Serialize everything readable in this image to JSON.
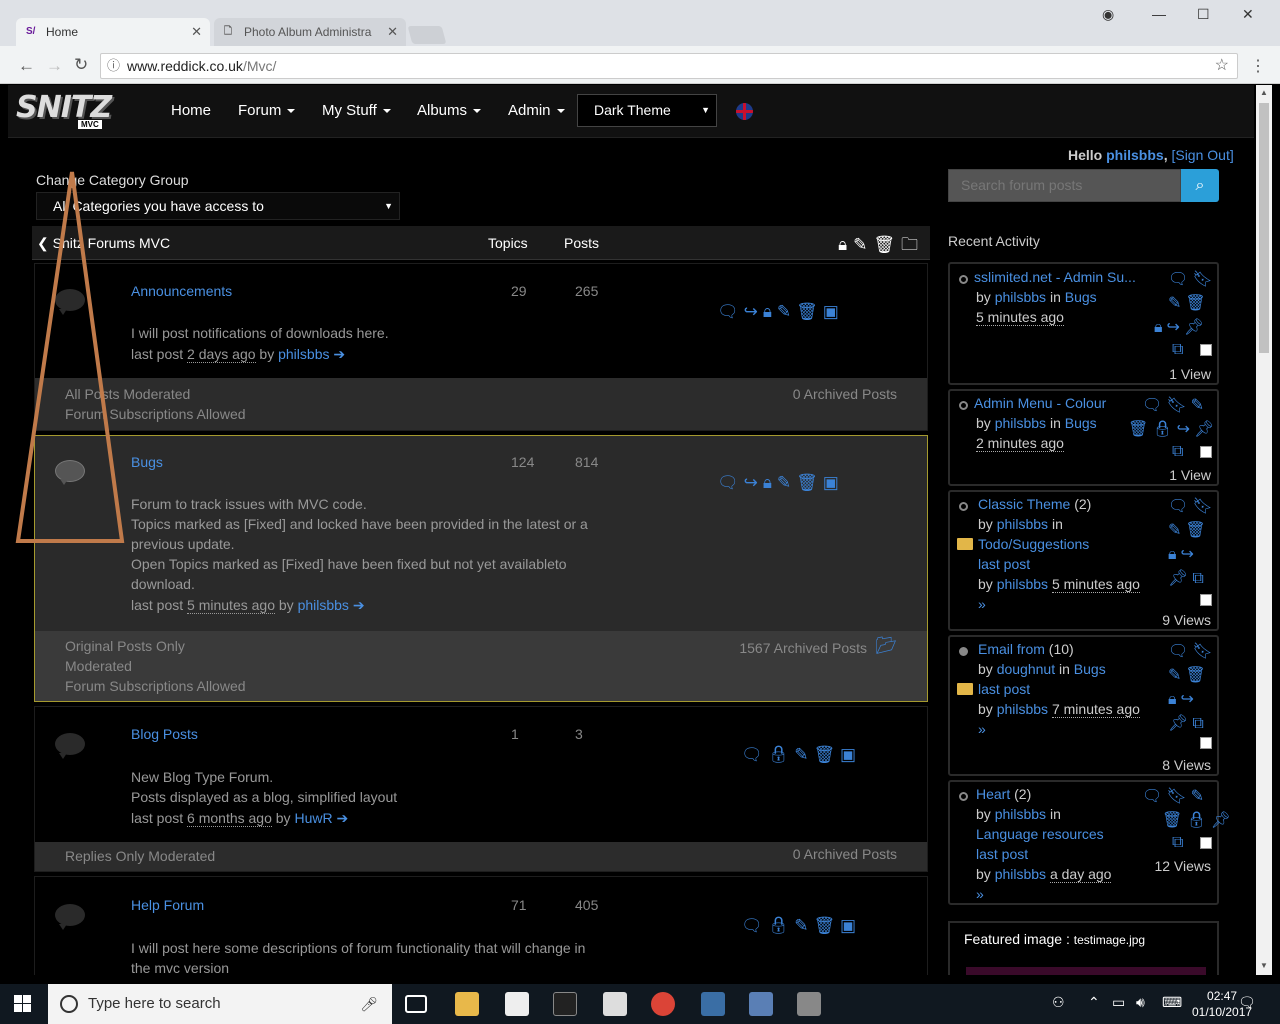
{
  "browser": {
    "tabs": [
      {
        "label": "Home",
        "icon": "snitz-favicon"
      },
      {
        "label": "Photo Album Administra",
        "icon": "document-icon"
      }
    ],
    "url_host": "www.reddick.co.uk",
    "url_path": "/Mvc/"
  },
  "nav": {
    "logo": "SNITZ",
    "logo_sub": "MVC",
    "items": [
      "Home",
      "Forum",
      "My Stuff",
      "Albums",
      "Admin"
    ],
    "theme_select": "Dark Theme"
  },
  "category": {
    "label": "Change Category Group",
    "selected": "All Categories you have access to"
  },
  "forum_header": {
    "title": "Snitz Forums MVC",
    "topics_col": "Topics",
    "posts_col": "Posts"
  },
  "forums": [
    {
      "name": "Announcements",
      "topics": "29",
      "posts": "265",
      "desc": [
        "I will post notifications of downloads here."
      ],
      "last_post_label": "last post",
      "last_post_ago": "2 days ago",
      "by": "by",
      "user": "philsbbs",
      "footer_left": [
        "All Posts Moderated",
        "Forum Subscriptions Allowed"
      ],
      "footer_right": "0 Archived Posts"
    },
    {
      "name": "Bugs",
      "topics": "124",
      "posts": "814",
      "desc": [
        "Forum to track issues with MVC code.",
        "Topics marked as [Fixed] and locked have been provided in the latest or a",
        "previous update.",
        "Open Topics marked as [Fixed] have been fixed but not yet availableto",
        "download."
      ],
      "last_post_label": "last post",
      "last_post_ago": "5 minutes ago",
      "by": "by",
      "user": "philsbbs",
      "footer_left": [
        "Original Posts Only",
        "Moderated",
        "Forum Subscriptions Allowed"
      ],
      "footer_right": "1567 Archived Posts"
    },
    {
      "name": "Blog Posts",
      "topics": "1",
      "posts": "3",
      "desc": [
        "New Blog Type Forum.",
        "Posts displayed as a blog, simplified layout"
      ],
      "last_post_label": "last post",
      "last_post_ago": "6 months ago",
      "by": "by",
      "user": "HuwR",
      "footer_left": [
        "Replies Only Moderated"
      ],
      "footer_right": "0 Archived Posts"
    },
    {
      "name": "Help Forum",
      "topics": "71",
      "posts": "405",
      "desc": [
        "I will post here some descriptions of forum functionality that will change in",
        "the mvc version"
      ]
    }
  ],
  "sidebar": {
    "hello": "Hello",
    "user": "philsbbs",
    "sign_out": "[Sign Out]",
    "search_placeholder": "Search forum posts",
    "recent_title": "Recent Activity",
    "recent": [
      {
        "title": "sslimited.net - Admin Su...",
        "by": "by",
        "author": "philsbbs",
        "in": "in",
        "forum": "Bugs",
        "ago": "5 minutes ago",
        "views": "1 View"
      },
      {
        "title": "Admin Menu - Colour",
        "by": "by",
        "author": "philsbbs",
        "in": "in",
        "forum": "Bugs",
        "ago": "2 minutes ago",
        "views": "1 View"
      },
      {
        "title": "Classic Theme",
        "count": "(2)",
        "by": "by",
        "author": "philsbbs",
        "in": "in",
        "forum": "Todo/Suggestions",
        "last_post": "last post",
        "last_by": "philsbbs",
        "ago": "5 minutes ago",
        "more": "»",
        "views": "9 Views"
      },
      {
        "title": "Email from",
        "count": "(10)",
        "by": "by",
        "author": "doughnut",
        "in": "in",
        "forum": "Bugs",
        "last_post": "last post",
        "last_by": "philsbbs",
        "ago": "7 minutes ago",
        "more": "»",
        "views": "8 Views"
      },
      {
        "title": "Heart",
        "count": "(2)",
        "by": "by",
        "author": "philsbbs",
        "in": "in",
        "forum": "Language resources",
        "last_post": "last post",
        "last_by": "philsbbs",
        "ago": "a day ago",
        "more": "»",
        "views": "12 Views"
      }
    ],
    "featured_label": "Featured image :",
    "featured_file": "testimage.jpg"
  },
  "taskbar": {
    "search": "Type here to search",
    "time": "02:47",
    "date": "01/10/2017"
  }
}
